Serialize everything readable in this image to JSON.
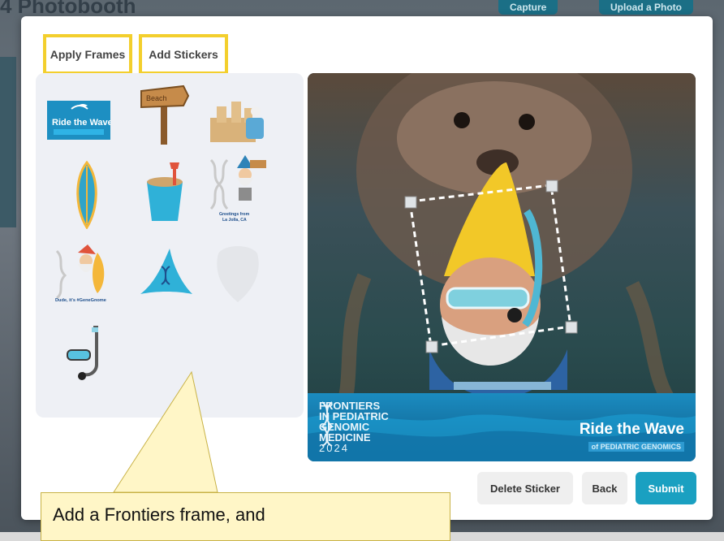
{
  "background": {
    "app_title": "4 Photobooth",
    "capture_label": "Capture",
    "upload_label": "Upload a Photo"
  },
  "tabs": [
    {
      "label": "Apply Frames"
    },
    {
      "label": "Add Stickers"
    }
  ],
  "stickers": [
    {
      "name": "ride-the-wave-logo",
      "text": "Ride the Wave",
      "subtext": "of PEDIATRIC GENOMICS"
    },
    {
      "name": "beach-sign",
      "text": "Beach"
    },
    {
      "name": "sandcastle"
    },
    {
      "name": "surfboard"
    },
    {
      "name": "sand-bucket"
    },
    {
      "name": "gnome-greetings",
      "text": "Greetings from La Jolla, CA"
    },
    {
      "name": "gnome-surfer",
      "text": "Dude, it's #GeneGnome"
    },
    {
      "name": "gnome-hat"
    },
    {
      "name": "gnome-beard"
    },
    {
      "name": "snorkel"
    }
  ],
  "photo_frame": {
    "left_text_lines": [
      "FRONTIERS",
      "IN PEDIATRIC",
      "GENOMIC",
      "MEDICINE",
      "2024"
    ],
    "right_title": "Ride the Wave",
    "right_sub": "of PEDIATRIC GENOMICS"
  },
  "buttons": {
    "delete_label": "Delete Sticker",
    "back_label": "Back",
    "submit_label": "Submit"
  },
  "callout": {
    "text": "Add a Frontiers frame, and"
  },
  "colors": {
    "highlight": "#f3cf2d",
    "accent": "#1aa0c1",
    "callout_bg": "#fff6c7"
  }
}
